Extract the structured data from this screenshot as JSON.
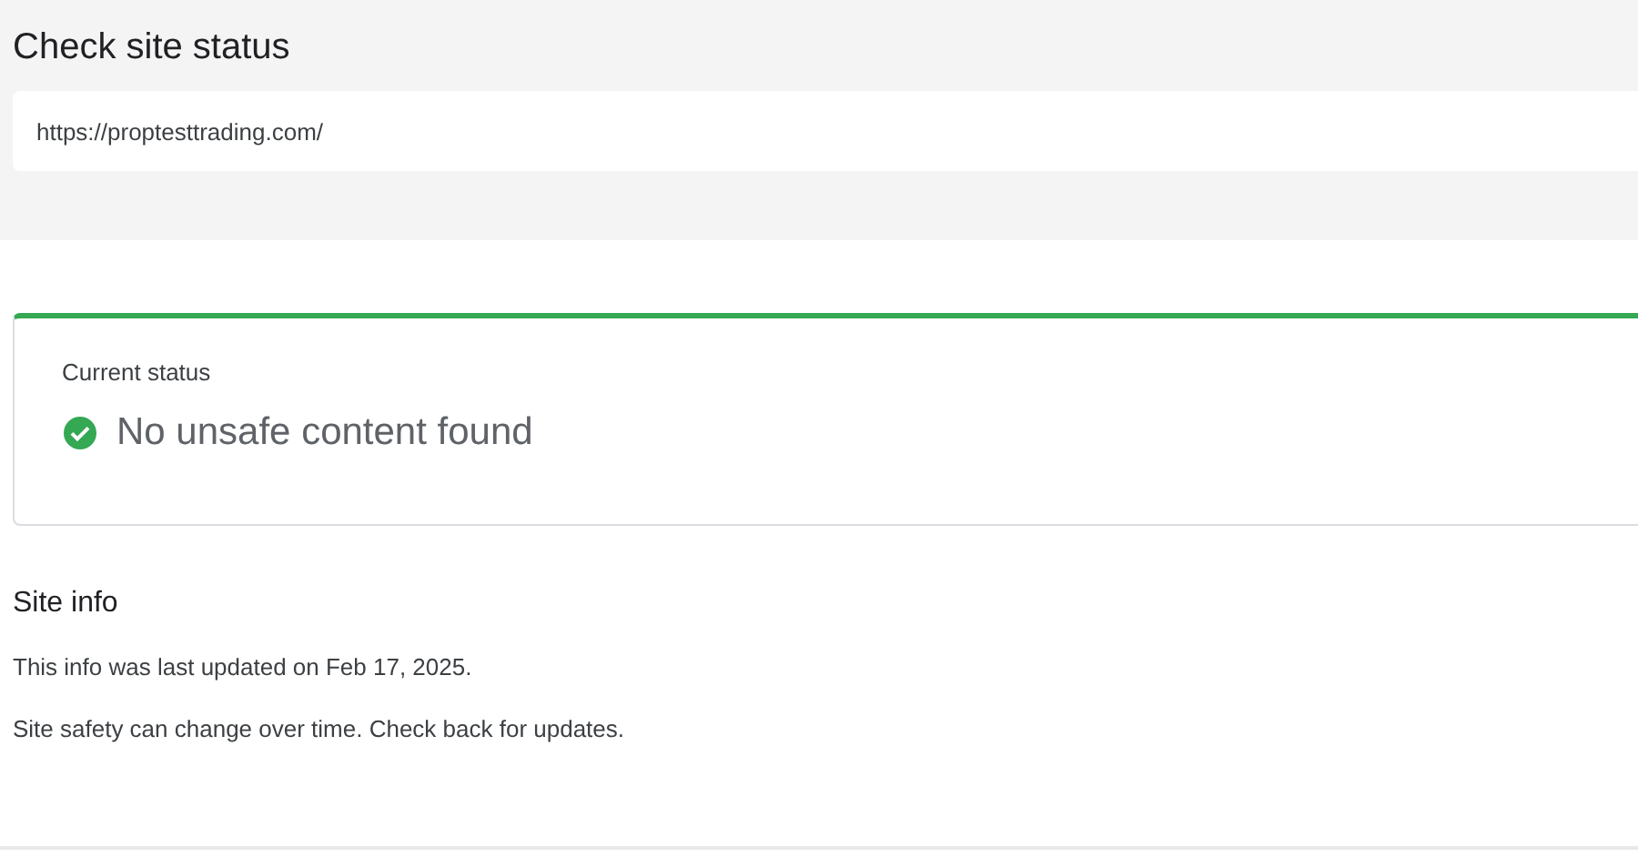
{
  "header": {
    "title": "Check site status",
    "url_field": {
      "value": "https://proptesttrading.com/"
    }
  },
  "status_card": {
    "label": "Current status",
    "status": {
      "kind": "safe",
      "text": "No unsafe content found"
    }
  },
  "site_info": {
    "heading": "Site info",
    "lines": [
      "This info was last updated on Feb 17, 2025.",
      "Site safety can change over time. Check back for updates."
    ]
  }
}
